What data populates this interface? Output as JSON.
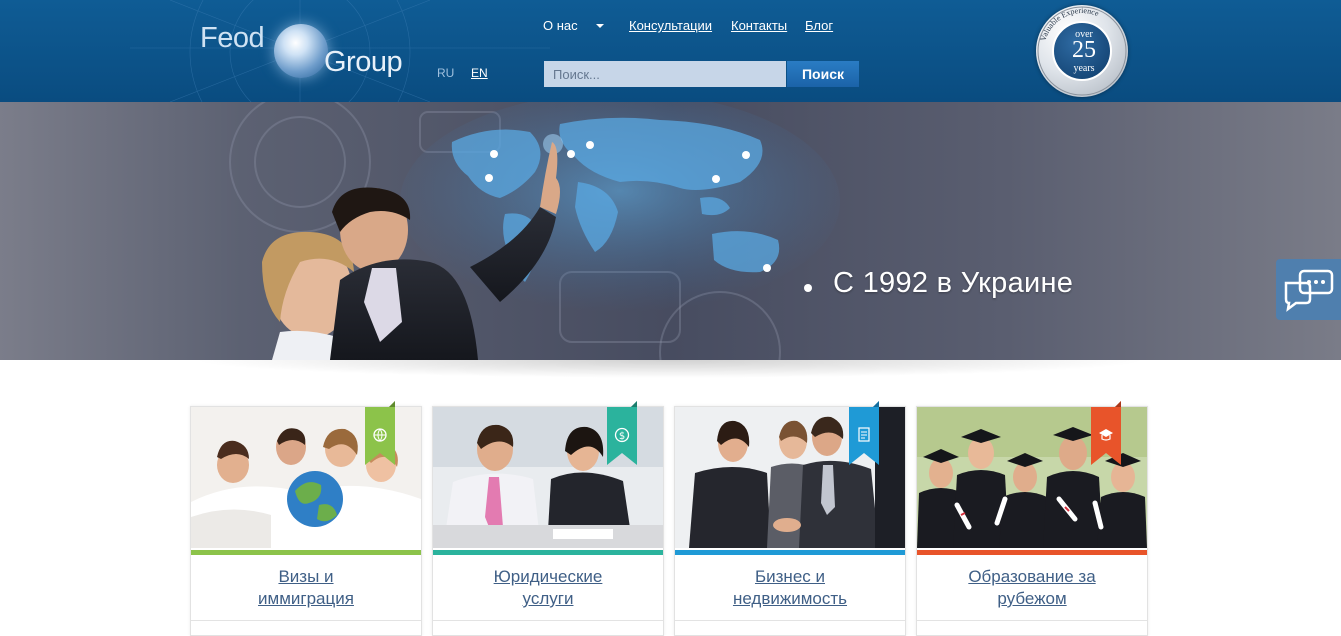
{
  "header": {
    "logo": {
      "word1": "Feod",
      "word2": "Group"
    },
    "languages": {
      "ru": "RU",
      "en": "EN"
    },
    "nav": {
      "about": "О нас",
      "consultations": "Консультации",
      "contacts": "Контакты",
      "blog": "Блог"
    },
    "search": {
      "placeholder": "Поиск...",
      "button": "Поиск"
    },
    "badge": {
      "over": "over",
      "number": "25",
      "years": "years",
      "ring": "Valuable Experience"
    }
  },
  "banner": {
    "headline": "С 1992 в Украине"
  },
  "cards": [
    {
      "title_line1": "Визы и",
      "title_line2": "иммиграция",
      "accent": "#8cc34a",
      "icon": "globe-icon"
    },
    {
      "title_line1": "Юридические",
      "title_line2": "услуги",
      "accent": "#2bb39d",
      "icon": "dollar-icon"
    },
    {
      "title_line1": "Бизнес и",
      "title_line2": "недвижимость",
      "accent": "#1f9ad6",
      "icon": "document-icon"
    },
    {
      "title_line1": "Образование за",
      "title_line2": "рубежом",
      "accent": "#e8542a",
      "icon": "graduation-cap-icon"
    }
  ],
  "colors": {
    "header_bg": "#0b4f85",
    "link": "#3f5f86",
    "search_button": "#1f6aae"
  }
}
